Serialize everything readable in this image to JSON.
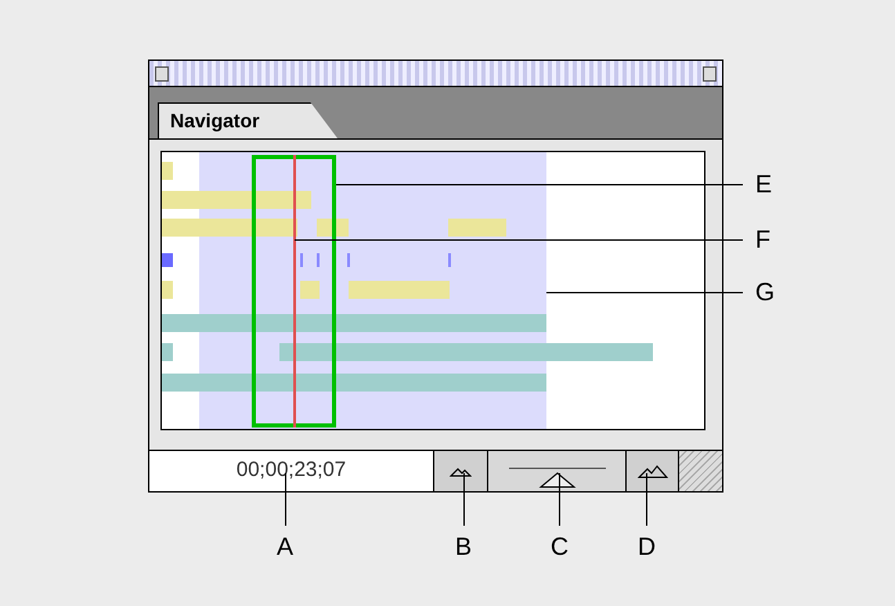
{
  "panel": {
    "tab": {
      "label": "Navigator",
      "selected": true
    },
    "timecode": "00;00;23;07",
    "zoom": {
      "level": 0.5
    }
  },
  "callouts": [
    {
      "label": "E",
      "kind": "right"
    },
    {
      "label": "F",
      "kind": "right"
    },
    {
      "label": "G",
      "kind": "right"
    },
    {
      "label": "A",
      "kind": "below"
    },
    {
      "label": "B",
      "kind": "below"
    },
    {
      "label": "C",
      "kind": "below"
    },
    {
      "label": "D",
      "kind": "below"
    }
  ]
}
